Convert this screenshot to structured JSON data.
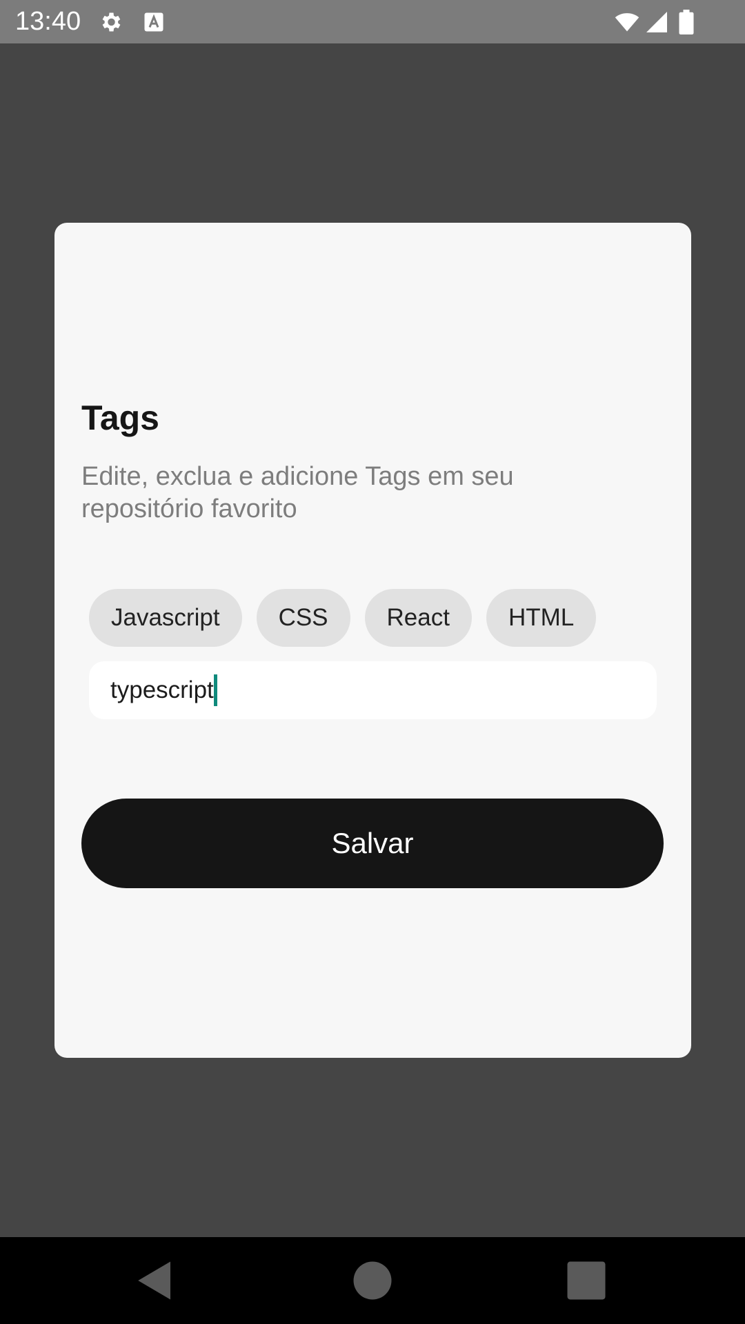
{
  "status_bar": {
    "time": "13:40",
    "icons": [
      "gear-icon",
      "keyboard-a-icon",
      "wifi-icon",
      "signal-icon",
      "battery-icon"
    ],
    "background_color": "#7c7c7c"
  },
  "dialog": {
    "title": "Tags",
    "subtitle": "Edite, exclua e adicione Tags em seu repositório favorito",
    "tags": [
      {
        "label": "Javascript"
      },
      {
        "label": "CSS"
      },
      {
        "label": "React"
      },
      {
        "label": "HTML"
      }
    ],
    "tag_input": {
      "value": "typescript",
      "cursor_color": "#0f8a7c"
    },
    "save_label": "Salvar",
    "save_color": "#151515"
  },
  "nav_bar": {
    "buttons": [
      "back-icon",
      "home-icon",
      "recents-icon"
    ]
  }
}
